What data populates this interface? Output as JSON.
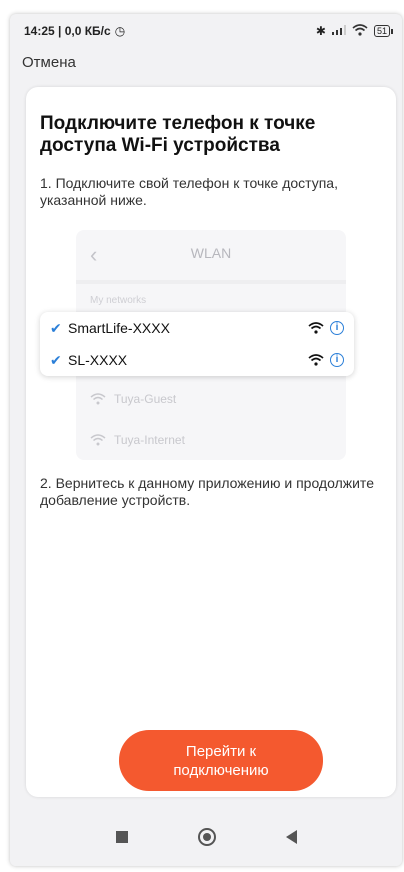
{
  "statusbar": {
    "time_speed": "14:25 | 0,0 КБ/с",
    "battery": "51"
  },
  "header": {
    "cancel_label": "Отмена"
  },
  "card": {
    "title": "Подключите телефон к точке доступа Wi-Fi устройства",
    "step1": "1. Подключите свой телефон к точке доступа, указанной ниже.",
    "step2": "2. Вернитесь к данному приложению и продолжите добавление устройств."
  },
  "illustration": {
    "header_title": "WLAN",
    "section_label": "My networks",
    "networks_highlighted": [
      {
        "name": "SmartLife-XXXX"
      },
      {
        "name": "SL-XXXX"
      }
    ],
    "networks_other": [
      {
        "name": "Tuya-Guest"
      },
      {
        "name": "Tuya-Internet"
      }
    ]
  },
  "action": {
    "connect_label": "Перейти к\nподключению"
  },
  "colors": {
    "accent": "#f4592f",
    "link_blue": "#2b7fd8"
  }
}
